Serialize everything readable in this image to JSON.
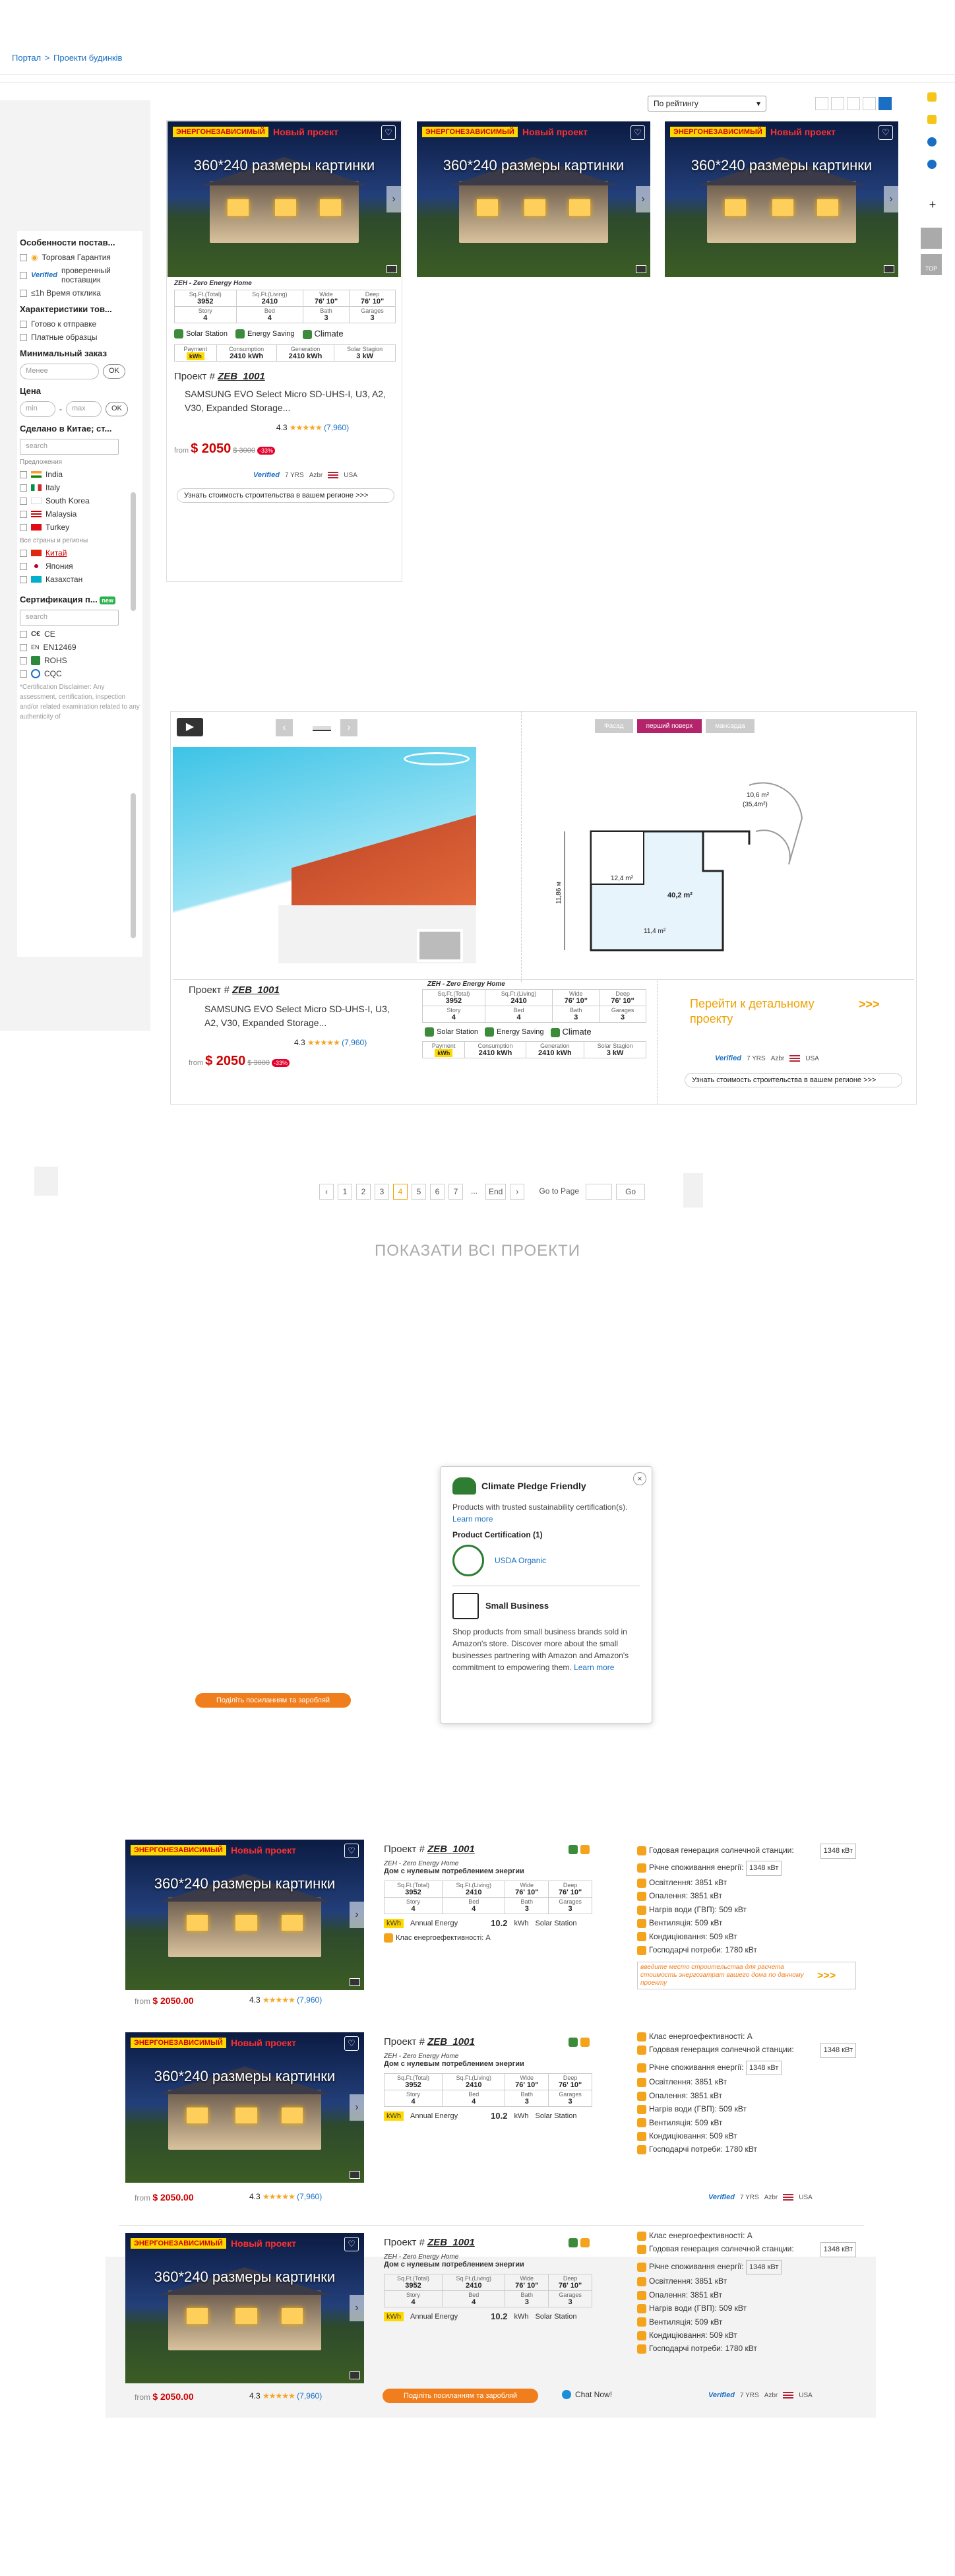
{
  "breadcrumb": {
    "root": "Портал",
    "sep": ">",
    "current": "Проекти будинків"
  },
  "toolbar": {
    "sort": "По рейтингу"
  },
  "filters": {
    "features_title": "Особенности постав...",
    "trade": "Торговая Гарантия",
    "verified_brand": "Verified",
    "verified": "проверенный поставщик",
    "response": "≤1h Время отклика",
    "goods_title": "Характеристики тов...",
    "ready": "Готово к отправке",
    "paid": "Платные образцы",
    "moq_title": "Минимальный заказ",
    "less": "Менее",
    "ok": "OK",
    "price_title": "Цена",
    "min": "min",
    "max": "max",
    "dash": "-",
    "made_title": "Сделано в Китае; ст...",
    "search": "search",
    "suggest": "Предложения",
    "countries": [
      "India",
      "Italy",
      "South Korea",
      "Malaysia",
      "Turkey"
    ],
    "all_label": "Все страны и регионы",
    "countries2": [
      "Китай",
      "Япония",
      "Казахстан"
    ],
    "cert_title": "Сертификация п...",
    "new": "new",
    "certs": [
      "CE",
      "EN12469",
      "ROHS",
      "CQC"
    ],
    "cert_note": "*Certification Disclaimer: Any assessment, certification, inspection and/or related examination related to any authenticity of"
  },
  "hero": {
    "badge": "ЭНЕРГОНЕЗАВИСИМЫЙ",
    "badge_red": "Новый проект",
    "caption": "360*240 размеры картинки"
  },
  "grid_card": {
    "zeh": "ZEH - Zero Energy Home",
    "specs": [
      [
        "Sq.Ft.(Total)",
        "3952"
      ],
      [
        "Sq.Ft.(Living)",
        "2410"
      ],
      [
        "Wide",
        "76' 10\""
      ],
      [
        "Deep",
        "76' 10\""
      ],
      [
        "Story",
        "4"
      ],
      [
        "Bed",
        "4"
      ],
      [
        "Bath",
        "3"
      ],
      [
        "Garages",
        "3"
      ]
    ],
    "features": [
      "Solar Station",
      "Energy Saving",
      "Climate"
    ],
    "energy": [
      [
        "Payment",
        "kWh"
      ],
      [
        "Consumption",
        "2410 kWh"
      ],
      [
        "Generation",
        "2410 kWh"
      ],
      [
        "Solar Stagion",
        "3 kW"
      ]
    ],
    "project_prefix": "Проект #",
    "project_id": "ZEB_1001",
    "desc": "SAMSUNG EVO Select Micro SD-UHS-I, U3, A2, V30, Expanded Storage...",
    "rating": "4.3",
    "reviews": "(7,960)",
    "from": "from",
    "price": "$ 2050",
    "old_price": "$ 3000",
    "discount": "-33%",
    "verified": "Verified",
    "years": "7 YRS",
    "aabr": "Azbr",
    "country": "USA",
    "cta": "Узнать стоимость строительства в вашем регионе >>>"
  },
  "detail": {
    "tabs": [
      "Фасад",
      "перший поверх",
      "мансарда"
    ],
    "plan_labels": [
      "10,6 m²",
      "(35,4m²)",
      "12,4 m²",
      "40,2 m²",
      "11,4 m²",
      "11,86 м"
    ],
    "go": "Перейти к детальному проекту",
    "arrows": ">>>"
  },
  "pagination": {
    "pages": [
      "1",
      "2",
      "3",
      "4",
      "5",
      "6",
      "7",
      "...",
      "End"
    ],
    "active": "4",
    "goto": "Go to Page",
    "go": "Go"
  },
  "show_all": "ПОКАЗАТИ ВСІ ПРОЕКТИ",
  "popup": {
    "t1": "Climate Pledge Friendly",
    "p1": "Products with trusted sustainability certification(s).",
    "learn": "Learn more",
    "cert": "Product Certification (1)",
    "usda": "USDA Organic",
    "t2": "Small Business",
    "p2": "Shop products from small business brands sold in Amazon's store. Discover more about the small businesses partnering with Amazon and Amazon's commitment to empowering them."
  },
  "share_pill": "Поділіть посиланням та заробляй",
  "list": {
    "zeh_ua": "Дом с нулевым потреблением энергии",
    "annual": "Annual Energy",
    "annual_val": "10.2",
    "kwh": "kWh",
    "class": "Клас енергоефективності: A",
    "gen": "Годовая генерация солнечной станции:",
    "gen_val": "1348 кВт",
    "cons": "Річне споживання енергії:",
    "cons_val": "1348 кВт",
    "items": [
      "Освітлення: 3851 кВт",
      "Опалення: 3851 кВт",
      "Нагрів води (ГВП): 509 кВт",
      "Вентиляція: 509 кВт",
      "Кондиціювання: 509 кВт",
      "Господарчі потреби: 1780 кВт"
    ],
    "calc": "введите место строительства для расчета стоимость энергозатрат вашего дома по данному проекту",
    "price": "$ 2050.00",
    "chat": "Chat Now!"
  },
  "colors": {
    "link": "#1a6fc4",
    "accent": "#f07e1d",
    "price": "#cc0000",
    "plum": "#b3246a"
  }
}
